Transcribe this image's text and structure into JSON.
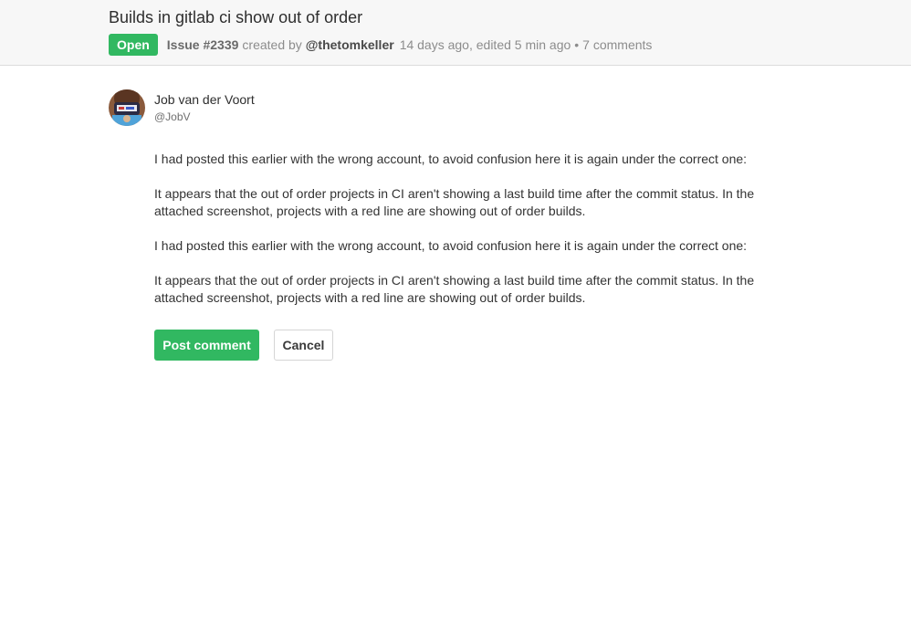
{
  "issue": {
    "title": "Builds in gitlab ci show out of order",
    "status": "Open",
    "number": "Issue #2339",
    "created_label": "created by",
    "author": "@thetomkeller",
    "time_text": "14 days ago, edited 5 min ago",
    "separator": "•",
    "comments_count": "7 comments"
  },
  "comment": {
    "user_name": "Job van der Voort",
    "user_handle": "@JobV",
    "paragraphs": [
      "I had posted this earlier with the wrong account, to avoid confusion here it is again under the correct one:",
      "It appears that the out of order projects in CI aren't showing a last build time after the commit status. In the attached screenshot, projects with a red line are showing out of order builds.",
      "I had posted this earlier with the wrong account, to avoid confusion here it is again under the correct one:",
      "It appears that the out of order projects in CI aren't showing a last build time after the commit status. In the attached screenshot, projects with a red line are showing out of order builds."
    ],
    "avatar_icon": "user-avatar"
  },
  "actions": {
    "post_label": "Post comment",
    "cancel_label": "Cancel"
  },
  "colors": {
    "accent_green": "#31b861",
    "header_bg": "#f7f7f7"
  }
}
